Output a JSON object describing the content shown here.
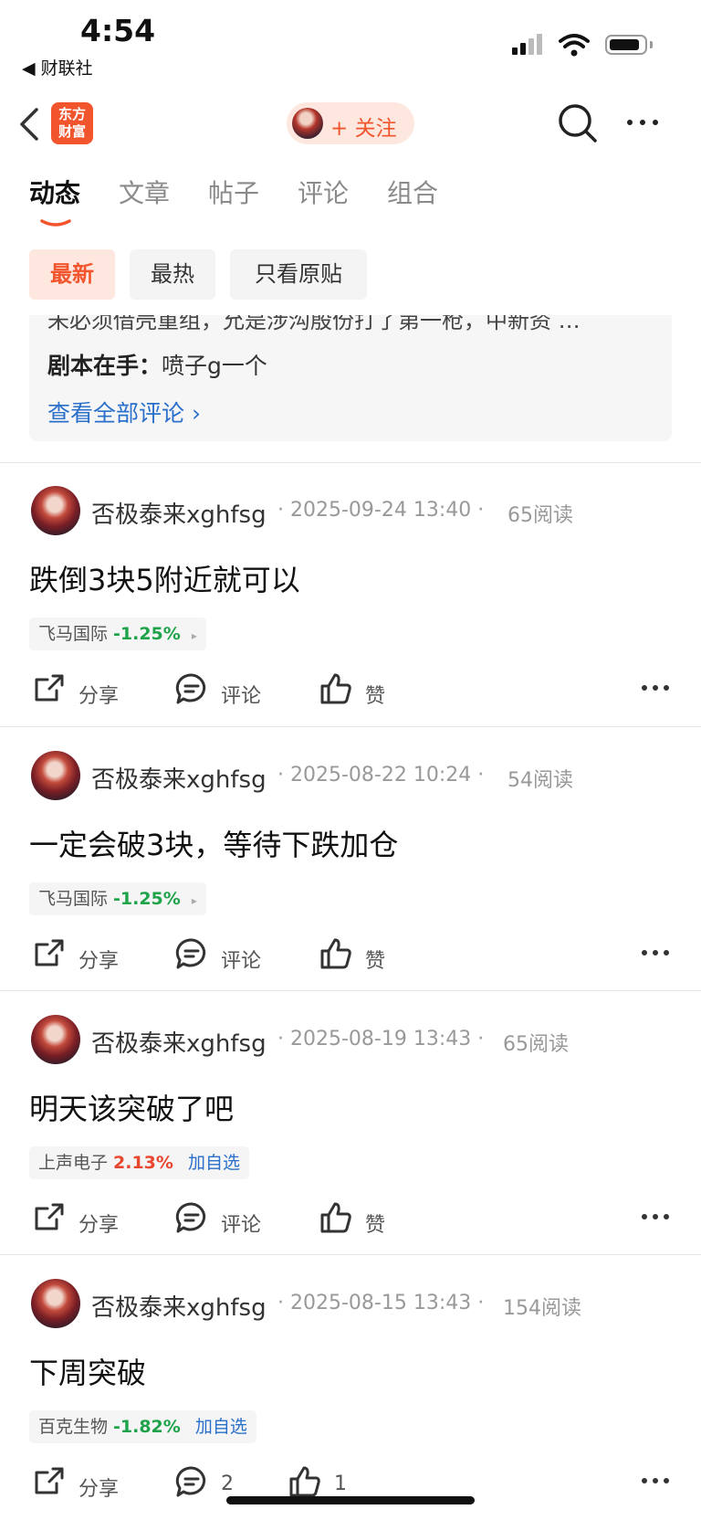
{
  "status_bar": {
    "time": "4:54",
    "back_app": "◀ 财联社"
  },
  "nav": {
    "logo_text_1": "东方",
    "logo_text_2": "财富",
    "follow_label": "+ 关注"
  },
  "tabs": [
    {
      "label": "动态",
      "active": true
    },
    {
      "label": "文章",
      "active": false
    },
    {
      "label": "帖子",
      "active": false
    },
    {
      "label": "评论",
      "active": false
    },
    {
      "label": "组合",
      "active": false
    }
  ],
  "filters": [
    {
      "label": "最新",
      "active": true
    },
    {
      "label": "最热",
      "active": false
    },
    {
      "label": "只看原贴",
      "active": false
    }
  ],
  "comment_box": {
    "clipped_line": "未必须借壳重组，允是涉沟殷份打了第一枪，中新资 …",
    "author": "剧本在手：",
    "text": "喷子g一个",
    "view_all": "查看全部评论 ›"
  },
  "actions": {
    "share": "分享",
    "comment": "评论",
    "like": "赞"
  },
  "posts": [
    {
      "author": "否极泰来xghfsg",
      "date": "· 2025-09-24 13:40 ·",
      "reads": "65阅读",
      "text": "跌倒3块5附近就可以",
      "stock_name": "飞马国际",
      "stock_change": "-1.25%",
      "stock_dir": "down",
      "tag_suffix": "▸",
      "comment_count": "评论",
      "like_count": "赞"
    },
    {
      "author": "否极泰来xghfsg",
      "date": "· 2025-08-22 10:24 ·",
      "reads": "54阅读",
      "text": "一定会破3块，等待下跌加仓",
      "stock_name": "飞马国际",
      "stock_change": "-1.25%",
      "stock_dir": "down",
      "tag_suffix": "▸",
      "comment_count": "评论",
      "like_count": "赞"
    },
    {
      "author": "否极泰来xghfsg",
      "date": "· 2025-08-19 13:43 ·",
      "reads": "65阅读",
      "text": "明天该突破了吧",
      "stock_name": "上声电子",
      "stock_change": "2.13%",
      "stock_dir": "up",
      "tag_suffix": "加自选",
      "comment_count": "评论",
      "like_count": "赞"
    },
    {
      "author": "否极泰来xghfsg",
      "date": "· 2025-08-15 13:43 ·",
      "reads": "154阅读",
      "text": "下周突破",
      "stock_name": "百克生物",
      "stock_change": "-1.82%",
      "stock_dir": "down",
      "tag_suffix": "加自选",
      "comment_count": "2",
      "like_count": "1"
    }
  ],
  "colors": {
    "accent": "#f2542d",
    "link": "#2a6fc9",
    "down": "#1fa34a",
    "up": "#e8462f"
  }
}
